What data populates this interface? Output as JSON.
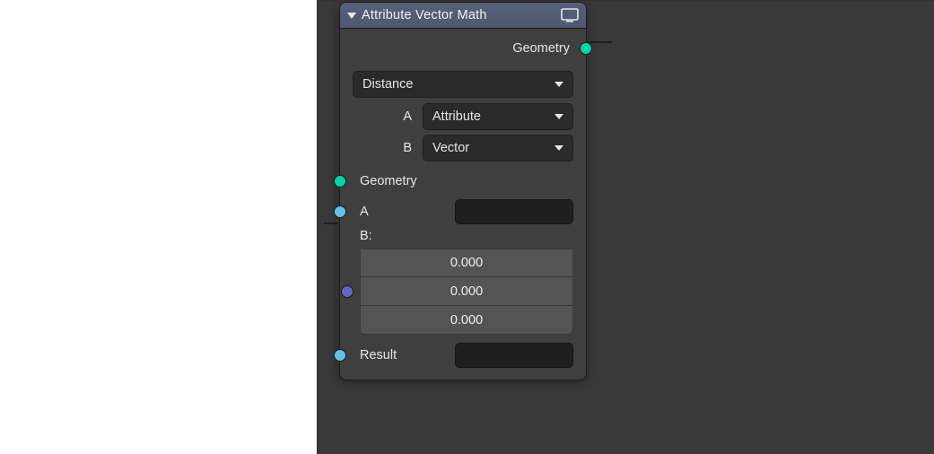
{
  "node": {
    "title": "Attribute Vector Math",
    "outputs": {
      "geometry": "Geometry"
    },
    "operation": "Distance",
    "type_a": {
      "label": "A",
      "value": "Attribute"
    },
    "type_b": {
      "label": "B",
      "value": "Vector"
    },
    "inputs": {
      "geometry": "Geometry",
      "a_label": "A",
      "a_value": "",
      "b_label": "B:",
      "b_vec": {
        "x": "0.000",
        "y": "0.000",
        "z": "0.000"
      },
      "result_label": "Result",
      "result_value": ""
    }
  },
  "colors": {
    "geometry": "#00d6a3",
    "float": "#63c3e6",
    "vector": "#6363c7",
    "header": "#535c75"
  }
}
